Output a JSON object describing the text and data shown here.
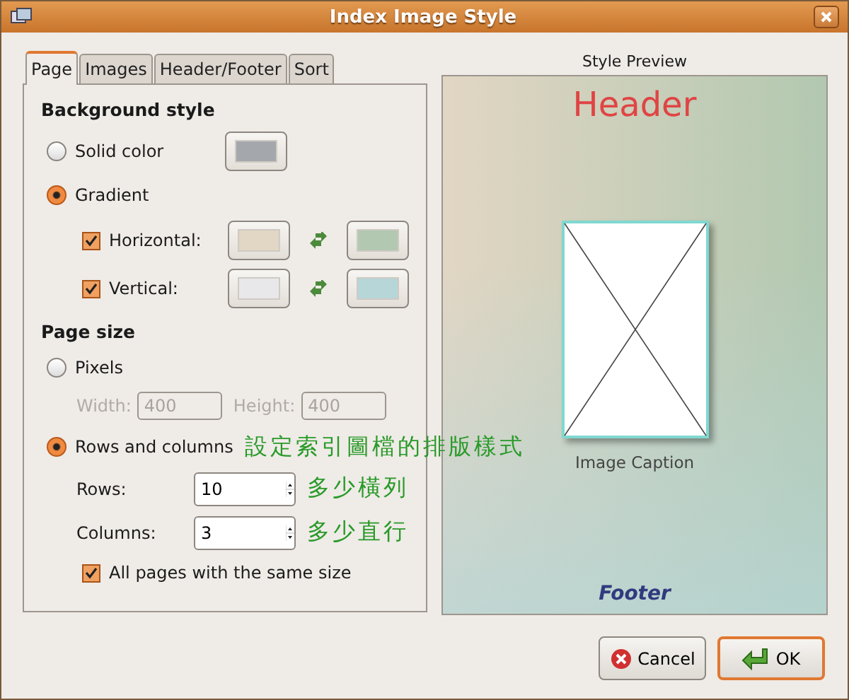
{
  "window": {
    "title": "Index Image Style"
  },
  "tabs": [
    {
      "label": "Page",
      "selected": true
    },
    {
      "label": "Images",
      "selected": false
    },
    {
      "label": "Header/Footer",
      "selected": false
    },
    {
      "label": "Sort",
      "selected": false
    }
  ],
  "background_style": {
    "heading": "Background style",
    "options": [
      {
        "label": "Solid color",
        "selected": false,
        "swatch": {
          "color": "#a4a8ac"
        }
      },
      {
        "label": "Gradient",
        "selected": true
      }
    ],
    "gradient": [
      {
        "label": "Horizontal:",
        "checked": true,
        "from": {
          "color": "#e2d6c4"
        },
        "to": {
          "color": "#b2c8b0"
        }
      },
      {
        "label": "Vertical:",
        "checked": true,
        "from": {
          "color": "#e8e8ea"
        },
        "to": {
          "color": "#b6d6d8"
        }
      }
    ]
  },
  "page_size": {
    "heading": "Page size",
    "pixels": {
      "label": "Pixels",
      "selected": false,
      "fields": [
        {
          "label": "Width:",
          "value": "400",
          "disabled": true
        },
        {
          "label": "Height:",
          "value": "400",
          "disabled": true
        }
      ]
    },
    "rows_and_columns": {
      "label": "Rows and columns",
      "selected": true,
      "annotation": "設定索引圖檔的排版樣式",
      "spinners": [
        {
          "label": "Rows:",
          "value": "10",
          "annotation": "多少橫列"
        },
        {
          "label": "Columns:",
          "value": "3",
          "annotation": "多少直行"
        }
      ]
    },
    "same_size": {
      "label": "All pages with the same size",
      "checked": true
    }
  },
  "preview": {
    "title": "Style Preview",
    "header": "Header",
    "caption": "Image Caption",
    "footer": "Footer"
  },
  "buttons": [
    {
      "label": "Cancel",
      "kind": "cancel",
      "default": false
    },
    {
      "label": "OK",
      "kind": "ok",
      "default": true
    }
  ]
}
